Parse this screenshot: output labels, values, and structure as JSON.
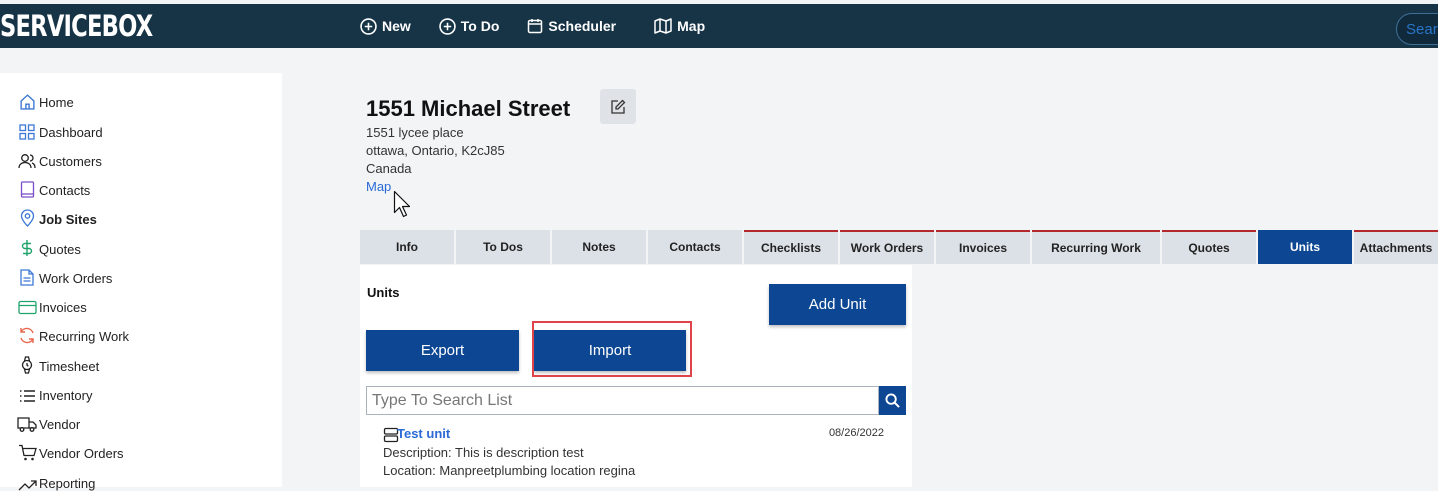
{
  "app": {
    "logo": "SERVICEBOX",
    "search_placeholder": "Sear"
  },
  "topnav": [
    {
      "label": "New",
      "icon": "plus-circle-icon"
    },
    {
      "label": "To Do",
      "icon": "plus-circle-icon"
    },
    {
      "label": "Scheduler",
      "icon": "calendar-icon"
    },
    {
      "label": "Map",
      "icon": "map-icon"
    }
  ],
  "sidebar": {
    "items": [
      {
        "label": "Home",
        "icon": "home-icon"
      },
      {
        "label": "Dashboard",
        "icon": "dashboard-icon"
      },
      {
        "label": "Customers",
        "icon": "users-icon"
      },
      {
        "label": "Contacts",
        "icon": "book-icon"
      },
      {
        "label": "Job Sites",
        "icon": "location-pin-icon",
        "active": true
      },
      {
        "label": "Quotes",
        "icon": "dollar-icon"
      },
      {
        "label": "Work Orders",
        "icon": "document-icon"
      },
      {
        "label": "Invoices",
        "icon": "credit-card-icon"
      },
      {
        "label": "Recurring Work",
        "icon": "refresh-icon"
      },
      {
        "label": "Timesheet",
        "icon": "watch-icon"
      },
      {
        "label": "Inventory",
        "icon": "list-icon"
      },
      {
        "label": "Vendor",
        "icon": "truck-icon"
      },
      {
        "label": "Vendor Orders",
        "icon": "cart-icon"
      },
      {
        "label": "Reporting",
        "icon": "trend-icon"
      }
    ]
  },
  "site": {
    "title": "1551 Michael Street",
    "address_line1": "1551 lycee place",
    "address_line2": "ottawa, Ontario, K2cJ85",
    "country": "Canada",
    "map_link": "Map"
  },
  "tabs": [
    {
      "label": "Info"
    },
    {
      "label": "To Dos"
    },
    {
      "label": "Notes"
    },
    {
      "label": "Contacts"
    },
    {
      "label": "Checklists"
    },
    {
      "label": "Work Orders"
    },
    {
      "label": "Invoices"
    },
    {
      "label": "Recurring Work"
    },
    {
      "label": "Quotes"
    },
    {
      "label": "Units",
      "active": true
    },
    {
      "label": "Attachments"
    }
  ],
  "units": {
    "title": "Units",
    "add_label": "Add Unit",
    "export_label": "Export",
    "import_label": "Import",
    "search_placeholder": "Type To Search List",
    "items": [
      {
        "name": "Test unit",
        "date": "08/26/2022",
        "description": "Description: This is description test",
        "location": "Location: Manpreetplumbing location regina"
      }
    ]
  },
  "colors": {
    "topbar": "#173447",
    "primary": "#0d4793",
    "link": "#2a6ad6",
    "highlight": "#e0444b",
    "tab_accent": "#b4272b"
  }
}
